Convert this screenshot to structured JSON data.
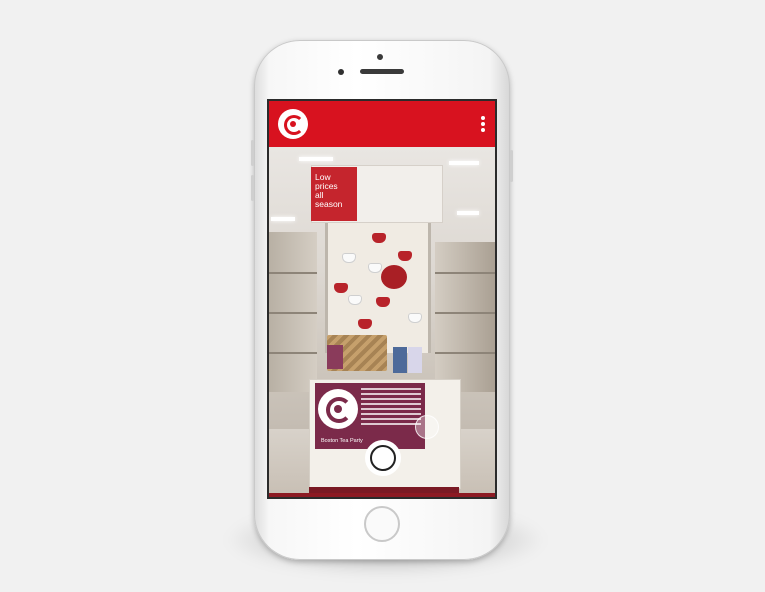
{
  "app": {
    "brand_color": "#d8121f",
    "logo_icon": "target-ar-logo-icon",
    "menu_icon": "more-vertical-icon"
  },
  "scene": {
    "sign": {
      "lines": [
        "Low",
        "prices",
        "all",
        "season"
      ]
    },
    "poster": {
      "title": "Boston Tea Party"
    }
  },
  "controls": {
    "shutter_icon": "camera-shutter-icon",
    "hotspot_icon": "ar-hotspot-icon"
  }
}
